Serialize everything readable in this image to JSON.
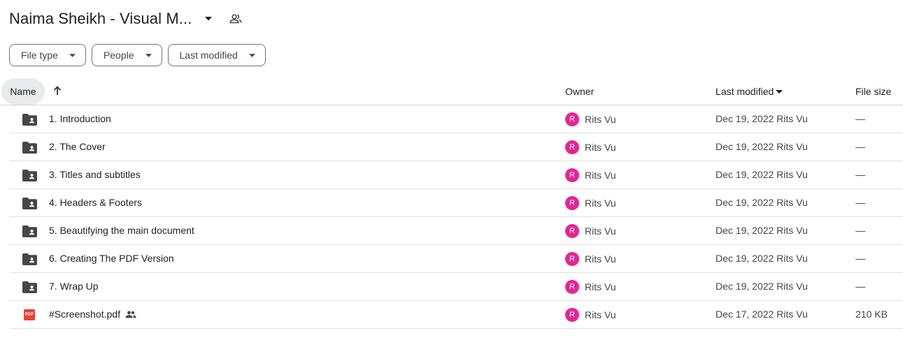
{
  "header": {
    "title": "Naima Sheikh - Visual M...",
    "filters": [
      {
        "label": "File type"
      },
      {
        "label": "People"
      },
      {
        "label": "Last modified"
      }
    ]
  },
  "columns": {
    "name": "Name",
    "owner": "Owner",
    "last_modified": "Last modified",
    "file_size": "File size"
  },
  "files": [
    {
      "name": "1. Introduction",
      "type": "shared-folder",
      "owner": "Rits Vu",
      "owner_initial": "R",
      "modified": "Dec 19, 2022 Rits Vu",
      "size": "—"
    },
    {
      "name": "2. The Cover",
      "type": "shared-folder",
      "owner": "Rits Vu",
      "owner_initial": "R",
      "modified": "Dec 19, 2022 Rits Vu",
      "size": "—"
    },
    {
      "name": "3. Titles and subtitles",
      "type": "shared-folder",
      "owner": "Rits Vu",
      "owner_initial": "R",
      "modified": "Dec 19, 2022 Rits Vu",
      "size": "—"
    },
    {
      "name": "4. Headers & Footers",
      "type": "shared-folder",
      "owner": "Rits Vu",
      "owner_initial": "R",
      "modified": "Dec 19, 2022 Rits Vu",
      "size": "—"
    },
    {
      "name": "5. Beautifying the main document",
      "type": "shared-folder",
      "owner": "Rits Vu",
      "owner_initial": "R",
      "modified": "Dec 19, 2022 Rits Vu",
      "size": "—"
    },
    {
      "name": "6. Creating The PDF Version",
      "type": "shared-folder",
      "owner": "Rits Vu",
      "owner_initial": "R",
      "modified": "Dec 19, 2022 Rits Vu",
      "size": "—"
    },
    {
      "name": "7. Wrap Up",
      "type": "shared-folder",
      "owner": "Rits Vu",
      "owner_initial": "R",
      "modified": "Dec 19, 2022 Rits Vu",
      "size": "—"
    },
    {
      "name": "#Screenshot.pdf",
      "type": "pdf",
      "pdf_label": "PDF",
      "shared": true,
      "owner": "Rits Vu",
      "owner_initial": "R",
      "modified": "Dec 17, 2022 Rits Vu",
      "size": "210 KB"
    }
  ],
  "colors": {
    "avatar": "#e52592",
    "pdf": "#ea4335",
    "folder": "#444746"
  }
}
